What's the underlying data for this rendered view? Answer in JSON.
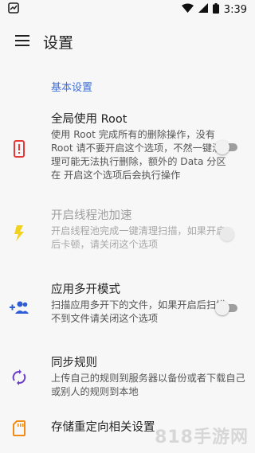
{
  "status_bar": {
    "time": "3:39"
  },
  "app_bar": {
    "title": "设置",
    "menu_icon": "menu-icon"
  },
  "section": {
    "header": "基本设置"
  },
  "settings": [
    {
      "title": "全局使用 Root",
      "summary": "使用 Root 完成所有的删除操作，没有 Root 请不要开启这个选项，不然一键清理可能无法执行删除，额外的 Data 分区在 开启这个选项后会执行操作",
      "icon": "phone-alert-icon",
      "icon_color": "#e5393a",
      "switch_on": false,
      "enabled": true
    },
    {
      "title": "开启线程池加速",
      "summary": "开启线程池完成一键清理扫描，如果开启后卡顿，请关闭这个选项",
      "icon": "flash-icon",
      "icon_color": "#f2d21a",
      "switch_on": false,
      "enabled": false
    },
    {
      "title": "应用多开模式",
      "summary": "扫描应用多开下的文件，如果开启后扫描不到文件请关闭这个选项",
      "icon": "add-user-group-icon",
      "icon_color": "#2d5cd6",
      "switch_on": false,
      "enabled": true
    },
    {
      "title": "同步规则",
      "summary": "上传自己的规则到服务器以备份或者下载自己或别人的规则到本地",
      "icon": "sync-icon",
      "icon_color": "#6a3fc7",
      "enabled": true
    },
    {
      "title": "存储重定向相关设置",
      "summary": "",
      "icon": "sd-card-icon",
      "icon_color": "#f08c17",
      "enabled": true
    }
  ],
  "watermark": "818手游网"
}
